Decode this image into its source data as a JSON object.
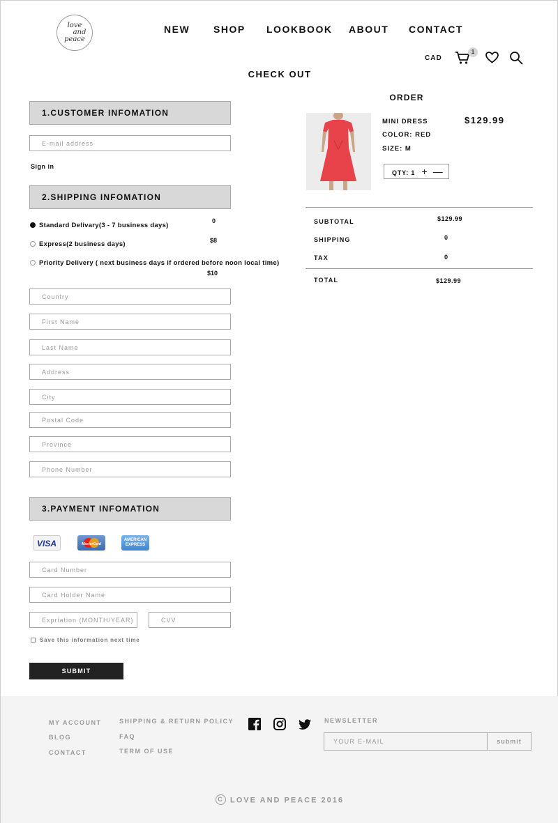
{
  "header": {
    "logo": {
      "line1": "love",
      "line2": "and",
      "line3": "peace"
    },
    "nav": [
      "NEW",
      "SHOP",
      "LOOKBOOK",
      "ABOUT",
      "CONTACT"
    ],
    "currency": "CAD",
    "cart_count": "1",
    "icons": [
      "cart-icon",
      "heart-icon",
      "search-icon"
    ]
  },
  "page_title": "CHECK OUT",
  "customer": {
    "heading": "1.CUSTOMER INFOMATION",
    "email_placeholder": "E-mail address",
    "sign_in": "Sign in"
  },
  "shipping": {
    "heading": "2.SHIPPING INFOMATION",
    "options": [
      {
        "label": "Standard Delivary(3 - 7 business days)",
        "price": "0",
        "selected": true
      },
      {
        "label": "Express(2 business days)",
        "price": "$8",
        "selected": false
      },
      {
        "label": "Priority Delivery ( next business days if ordered before noon local time)",
        "price": "$10",
        "selected": false
      }
    ],
    "fields": [
      "Country",
      "First Name",
      "Last Name",
      "Address",
      "City",
      "Postal Code",
      "Province",
      "Phone Number"
    ]
  },
  "payment": {
    "heading": "3.PAYMENT INFOMATION",
    "cards": [
      "VISA",
      "MasterCard",
      "AMERICAN EXPRESS"
    ],
    "card_number": "Card Number",
    "card_holder": "Card Holder Name",
    "expiration": "Expriation (MONTH/YEAR)",
    "cvv": "CVV",
    "save_info": "Save this information next time",
    "submit": "SUBMIT"
  },
  "order": {
    "title": "ORDER",
    "product": {
      "name": "MINI DRESS",
      "color": "COLOR: RED",
      "size": "SIZE: M",
      "price": "$129.99",
      "qty_label": "QTY: 1",
      "qty_plus": "+",
      "qty_minus": "—"
    },
    "summary": [
      {
        "label": "SUBTOTAL",
        "value": "$129.99"
      },
      {
        "label": "SHIPPING",
        "value": "0"
      },
      {
        "label": "TAX",
        "value": "0"
      }
    ],
    "total": {
      "label": "TOTAL",
      "value": "$129.99"
    }
  },
  "footer": {
    "col1": [
      "MY ACCOUNT",
      "BLOG",
      "CONTACT"
    ],
    "col2": [
      "SHIPPING & RETURN POLICY",
      "FAQ",
      "TERM OF USE"
    ],
    "social": [
      "facebook-icon",
      "instagram-icon",
      "twitter-icon"
    ],
    "newsletter_title": "NEWSLETTER",
    "newsletter_placeholder": "YOUR E-MAIL",
    "newsletter_submit": "submit",
    "copyright_symbol": "C",
    "copyright": "LOVE AND PEACE 2016"
  },
  "colors": {
    "section_bg": "#d8d8d8",
    "footer_bg": "#f4f4f4",
    "button_bg": "#222222",
    "dress": "#e8434a"
  }
}
